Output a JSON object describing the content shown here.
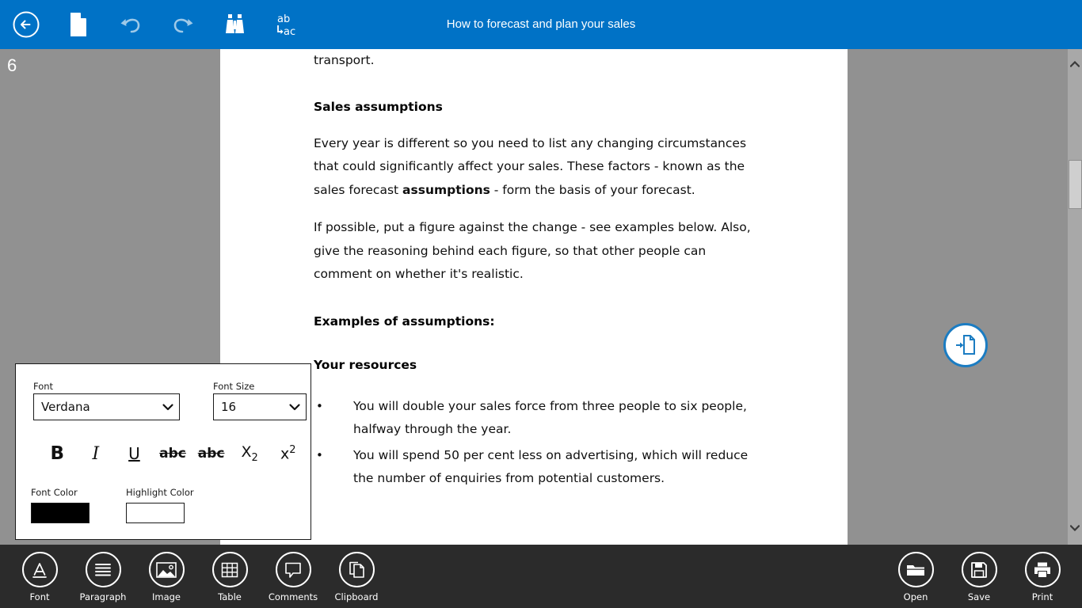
{
  "topbar": {
    "background": "#0072c6",
    "title": "How to forecast and plan your sales",
    "buttons": [
      {
        "name": "back-icon",
        "label": "Back"
      },
      {
        "name": "new-document-icon",
        "label": "New"
      },
      {
        "name": "undo-icon",
        "label": "Undo"
      },
      {
        "name": "redo-icon",
        "label": "Redo"
      },
      {
        "name": "find-icon",
        "label": "Find"
      },
      {
        "name": "replace-icon",
        "label": "Replace",
        "text_top": "ab",
        "text_bottom": "ac"
      }
    ]
  },
  "workspace": {
    "page_number": "6",
    "background": "#919191",
    "fab": {
      "name": "insert-page-icon",
      "label": "Insert page",
      "color": "#1b7cc2"
    }
  },
  "document": {
    "paragraph_top": "plan the necessary resources in areas such as production, storage and transport.",
    "heading_sales_assumptions": "Sales assumptions",
    "paragraph_every_year_a": "Every year is different so you need to list any changing circumstances that could significantly affect your sales. These factors - known as the sales forecast ",
    "paragraph_every_year_bold": "assumptions",
    "paragraph_every_year_b": " - form the basis of your forecast.",
    "paragraph_if_possible": "If possible, put a figure against the change - see examples below. Also, give the reasoning behind each figure, so that other people can comment on whether it's realistic.",
    "heading_examples": "Examples of assumptions:",
    "heading_your_resources": "Your resources",
    "bullets": [
      "You will double your sales force from three people to six people, halfway through the year.",
      "You will spend 50 per cent less on advertising, which will reduce the number of enquiries from potential customers."
    ],
    "bullet_glyph": "•"
  },
  "font_panel": {
    "font_label": "Font",
    "font_value": "Verdana",
    "font_size_label": "Font Size",
    "font_size_value": "16",
    "format_buttons": [
      {
        "name": "bold-button",
        "label": "B"
      },
      {
        "name": "italic-button",
        "label": "I"
      },
      {
        "name": "underline-button",
        "label": "U"
      },
      {
        "name": "strikethrough-button",
        "label": "abc"
      },
      {
        "name": "double-strikethrough-button",
        "label": "abc"
      },
      {
        "name": "subscript-button",
        "label": "X",
        "script": "2"
      },
      {
        "name": "superscript-button",
        "label": "x",
        "script": "2"
      }
    ],
    "font_color_label": "Font Color",
    "font_color_value": "#000000",
    "highlight_color_label": "Highlight Color",
    "highlight_color_value": "#ffffff"
  },
  "bottombar": {
    "background": "#2b2b2b",
    "left_items": [
      {
        "name": "bottom-item-font",
        "label": "Font",
        "icon": "font-a-icon"
      },
      {
        "name": "bottom-item-paragraph",
        "label": "Paragraph",
        "icon": "paragraph-lines-icon"
      },
      {
        "name": "bottom-item-image",
        "label": "Image",
        "icon": "image-picture-icon"
      },
      {
        "name": "bottom-item-table",
        "label": "Table",
        "icon": "table-grid-icon"
      },
      {
        "name": "bottom-item-comments",
        "label": "Comments",
        "icon": "comment-bubble-icon"
      },
      {
        "name": "bottom-item-clipboard",
        "label": "Clipboard",
        "icon": "clipboard-copy-icon"
      }
    ],
    "right_items": [
      {
        "name": "bottom-item-open",
        "label": "Open",
        "icon": "folder-open-icon"
      },
      {
        "name": "bottom-item-save",
        "label": "Save",
        "icon": "floppy-save-icon"
      },
      {
        "name": "bottom-item-print",
        "label": "Print",
        "icon": "printer-icon"
      }
    ]
  },
  "scrollbar": {
    "up_arrow": "⌃",
    "down_arrow": "⌄"
  }
}
